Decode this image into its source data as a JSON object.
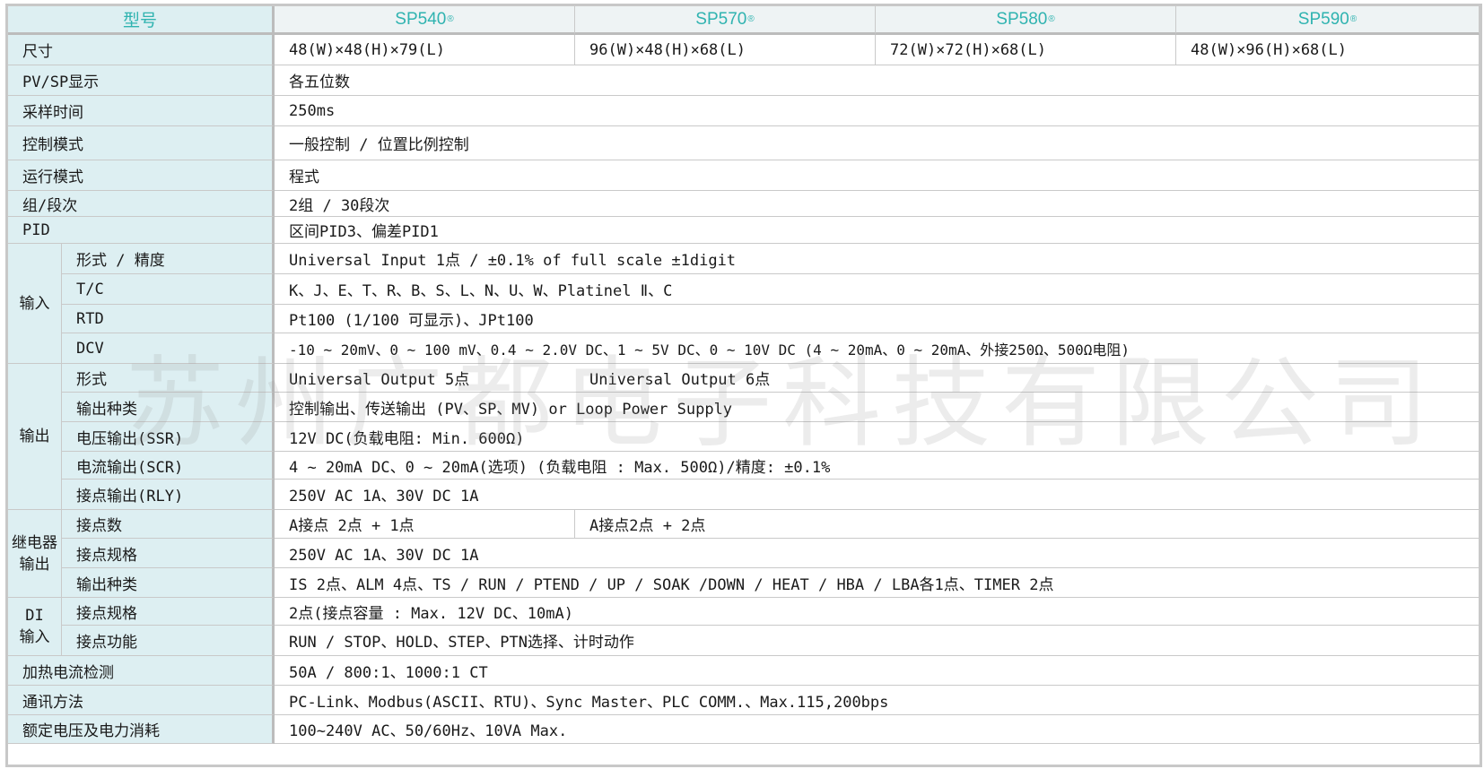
{
  "header": {
    "label": "型号",
    "models": [
      "SP540",
      "SP570",
      "SP580",
      "SP590"
    ],
    "mark": "®"
  },
  "rows": {
    "size": {
      "label": "尺寸",
      "values": [
        "48(W)×48(H)×79(L)",
        "96(W)×48(H)×68(L)",
        "72(W)×72(H)×68(L)",
        "48(W)×96(H)×68(L)"
      ]
    },
    "display": {
      "label": "PV/SP显示",
      "value": "各五位数"
    },
    "sampling": {
      "label": "采样时间",
      "value": "250ms"
    },
    "control_mode": {
      "label": "控制模式",
      "value": "一般控制 / 位置比例控制"
    },
    "run_mode": {
      "label": "运行模式",
      "value": "程式"
    },
    "group_segment": {
      "label": "组/段次",
      "value": "2组 / 30段次"
    },
    "pid": {
      "label": "PID",
      "value": "区间PID3、偏差PID1"
    },
    "input": {
      "label": "输入",
      "items": [
        {
          "label": "形式 / 精度",
          "value": "Universal Input 1点 / ±0.1% of full scale ±1digit"
        },
        {
          "label": "T/C",
          "value": "K、J、E、T、R、B、S、L、N、U、W、Platinel Ⅱ、C"
        },
        {
          "label": "RTD",
          "value": "Pt100 (1/100 可显示)、JPt100"
        },
        {
          "label": "DCV",
          "value": "-10 ~ 20mV、0 ~ 100 mV、0.4 ~ 2.0V DC、1 ~ 5V DC、0 ~ 10V DC (4 ~ 20mA、0 ~ 20mA、外接250Ω、500Ω电阻)"
        }
      ]
    },
    "output": {
      "label": "输出",
      "form": {
        "label": "形式",
        "value_a": "Universal Output 5点",
        "value_b": "Universal Output 6点"
      },
      "items": [
        {
          "label": "输出种类",
          "value": "控制输出、传送输出 (PV、SP、MV) or Loop Power Supply"
        },
        {
          "label": "电压输出(SSR)",
          "value": "12V DC(负载电阻: Min. 600Ω)"
        },
        {
          "label": "电流输出(SCR)",
          "value": "4 ~ 20mA DC、0 ~ 20mA(选项) (负载电阻 : Max. 500Ω)/精度: ±0.1%"
        },
        {
          "label": "接点输出(RLY)",
          "value": "250V AC 1A、30V DC 1A"
        }
      ]
    },
    "relay": {
      "label_line1": "继电器",
      "label_line2": "输出",
      "count": {
        "label": "接点数",
        "value_a": "A接点 2点 + 1点",
        "value_b": "A接点2点 + 2点"
      },
      "items": [
        {
          "label": "接点规格",
          "value": "250V AC 1A、30V DC 1A"
        },
        {
          "label": "输出种类",
          "value": "IS 2点、ALM 4点、TS / RUN / PTEND / UP / SOAK /DOWN / HEAT / HBA / LBA各1点、TIMER 2点"
        }
      ]
    },
    "di": {
      "label_line1": "DI",
      "label_line2": "输入",
      "items": [
        {
          "label": "接点规格",
          "value": "2点(接点容量 : Max. 12V DC、10mA)"
        },
        {
          "label": "接点功能",
          "value": "RUN / STOP、HOLD、STEP、PTN选择、计时动作"
        }
      ]
    },
    "heater_current": {
      "label": "加热电流检测",
      "value": "50A / 800:1、1000:1 CT"
    },
    "comm": {
      "label": "通讯方法",
      "value": "PC-Link、Modbus(ASCII、RTU)、Sync Master、PLC COMM.、Max.115,200bps"
    },
    "power": {
      "label": "额定电压及电力消耗",
      "value": "100~240V AC、50/60Hz、10VA Max."
    }
  },
  "watermark": "苏州广都电子科技有限公司",
  "colors": {
    "label_bg": "#ddeff2",
    "header_text": "#2fb3b0",
    "border": "#c9c9c9"
  }
}
